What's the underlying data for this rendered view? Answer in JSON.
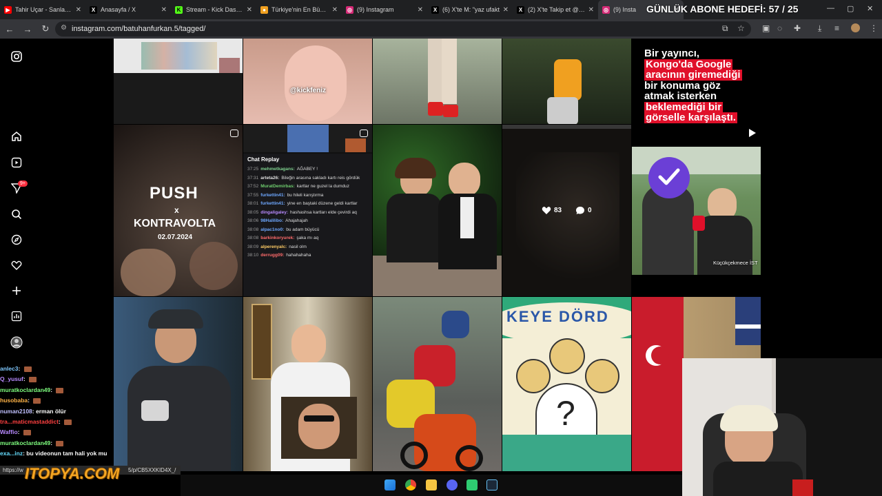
{
  "browser": {
    "tabs": [
      {
        "title": "Tahir Uçar - Sanlara B",
        "icon": "youtube-icon",
        "color": "#ff0000",
        "glyph": "▶"
      },
      {
        "title": "Anasayfa / X",
        "icon": "x-icon",
        "color": "#000000",
        "glyph": "X"
      },
      {
        "title": "Stream - Kick Dashbo",
        "icon": "kick-icon",
        "color": "#53fc18",
        "glyph": "K"
      },
      {
        "title": "Türkiye'nin En Büyük",
        "icon": "site-icon",
        "color": "#f0a020",
        "glyph": "●"
      },
      {
        "title": "(9) Instagram",
        "icon": "instagram-icon",
        "color": "#d62976",
        "glyph": "◎"
      },
      {
        "title": "(6) X'te M: \"yaz ufakt",
        "icon": "x-icon",
        "color": "#000000",
        "glyph": "X"
      },
      {
        "title": "(2) X'te Takip et @da",
        "icon": "x-icon",
        "color": "#000000",
        "glyph": "X"
      },
      {
        "title": "(9) Insta",
        "icon": "instagram-icon",
        "color": "#d62976",
        "glyph": "◎"
      }
    ],
    "url": "instagram.com/batuhanfurkan.5/tagged/",
    "status_url": "https://w",
    "status_url_tail": "5/p/CB5XXKID4X_/"
  },
  "stream_overlay": {
    "goal_title": "GÜNLÜK ABONE HEDEFİ: 57 / 25",
    "logo": "ITOPYA.COM"
  },
  "instagram": {
    "nav_badge": "9+",
    "nav_icons": [
      "instagram-logo-icon",
      "home-icon",
      "reels-icon",
      "messages-icon",
      "search-icon",
      "explore-icon",
      "notifications-icon",
      "create-icon",
      "dashboard-icon",
      "profile-icon"
    ],
    "posts": {
      "p2_caption": "@kickfeniz",
      "p5_text_line1": "Bir yayıncı,",
      "p5_text_line2": "Kongo'da Google",
      "p5_text_line3": "aracının giremediği",
      "p5_text_line4": "bir konuma göz",
      "p5_text_line5": "atmak isterken",
      "p5_text_line6": "beklemediği bir",
      "p5_text_line7": "görselle karşılaştı.",
      "push_title": "PUSH",
      "push_x": "x",
      "push_sub": "KONTRAVOLTA",
      "push_date": "02.07.2024",
      "hover_likes": "83",
      "hover_comments": "0",
      "news_caption": "Küçükçekmece İST",
      "drawing_text": "KEYE DÖRD"
    },
    "chat_replay": {
      "title": "Chat Replay",
      "rows": [
        {
          "time": "37:25",
          "user": "mehmetkagans:",
          "color": "#7fd18f",
          "msg": "AĞABEY !"
        },
        {
          "time": "37:31",
          "user": "arteta26:",
          "color": "#e0e0e0",
          "msg": "Bileğin arasına sakladı kartı reis gördük"
        },
        {
          "time": "37:52",
          "user": "MuratDemirbas:",
          "color": "#6fcf6f",
          "msg": "kartlar ne guzel la dumduz"
        },
        {
          "time": "37:55",
          "user": "furkettin41:",
          "color": "#6ea8ff",
          "msg": "bu hileli karıştırma"
        },
        {
          "time": "38:01",
          "user": "furkettin41:",
          "color": "#6ea8ff",
          "msg": "yine en baştaki düzene geldi kartlar"
        },
        {
          "time": "38:05",
          "user": "dingaligaley:",
          "color": "#b88aff",
          "msg": "hashashsa kartları elde çevirdi aq"
        },
        {
          "time": "38:06",
          "user": "98Halilibo:",
          "color": "#6ea8ff",
          "msg": "Ahajahajah"
        },
        {
          "time": "38:08",
          "user": "alpac1no0:",
          "color": "#6ea8ff",
          "msg": "bu adam büyücü"
        },
        {
          "time": "38:08",
          "user": "barkinkoryurek:",
          "color": "#ff6b6b",
          "msg": "şaka mı aq"
        },
        {
          "time": "38:09",
          "user": "alperenyalc:",
          "color": "#ffcc66",
          "msg": "nasil olm"
        },
        {
          "time": "38:10",
          "user": "derrugg09:",
          "color": "#ff6b6b",
          "msg": "hahahahaha"
        }
      ]
    }
  },
  "stream_chat": [
    {
      "user": "anlec3",
      "color": "#7ec8ff",
      "msg": ""
    },
    {
      "user": "Q_yusuf",
      "color": "#b88aff",
      "msg": ""
    },
    {
      "user": "muratkoclardan49",
      "color": "#7fff7f",
      "msg": ""
    },
    {
      "user": "husobaba",
      "color": "#ffb347",
      "msg": ""
    },
    {
      "user": "numan2108",
      "color": "#c0c0ff",
      "msg": "erman ölür"
    },
    {
      "user": "tra...maticmastaddict",
      "color": "#ff4040",
      "msg": ""
    },
    {
      "user": "Waffio",
      "color": "#b88aff",
      "msg": ""
    },
    {
      "user": "muratkoclardan49",
      "color": "#7fff7f",
      "msg": ""
    },
    {
      "user": "exa...inz",
      "color": "#66ddff",
      "msg": "bu videonun tam hali yok mu"
    }
  ]
}
